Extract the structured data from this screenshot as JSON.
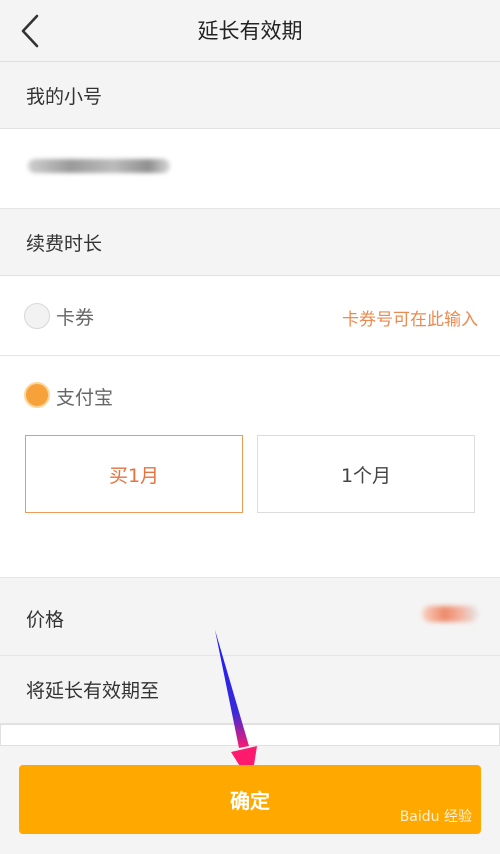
{
  "header": {
    "title": "延长有效期",
    "back_icon": "chevron-left-icon"
  },
  "sections": {
    "my_account": "我的小号",
    "renew_duration": "续费时长",
    "price": "价格",
    "extend_until": "将延长有效期至"
  },
  "payment": {
    "card_label": "卡券",
    "card_hint": "卡券号可在此输入",
    "alipay_label": "支付宝",
    "selected_method": "支付宝"
  },
  "durations": {
    "options": [
      "买1月",
      "1个月"
    ],
    "selected": "买1月"
  },
  "confirm_label": "确定",
  "watermark": "Baidu 经验",
  "colors": {
    "accent": "#ffa800",
    "selected_border": "#ed9b58",
    "hint_text": "#ec8a4e",
    "radio_on": "#f7a13a"
  }
}
